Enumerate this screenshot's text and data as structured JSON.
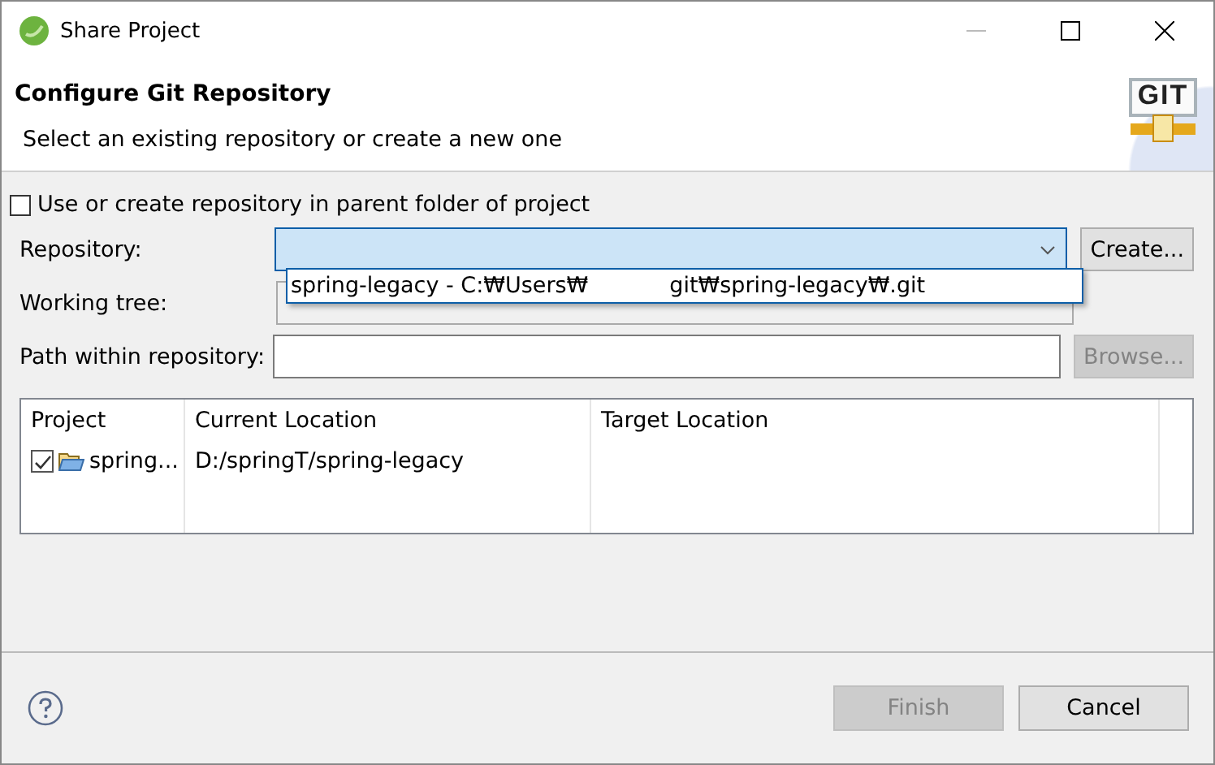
{
  "window": {
    "title": "Share Project"
  },
  "header": {
    "title": "Configure Git Repository",
    "description": "Select an existing repository or create a new one",
    "logo": "GIT"
  },
  "parent_folder_option": {
    "label": "Use or create repository in parent folder of project",
    "checked": false
  },
  "repository": {
    "label": "Repository:",
    "expanded": true,
    "options": [
      {
        "parts": [
          "spring-legacy - C:₩Users₩",
          "git₩spring-legacy₩.git"
        ],
        "selected": true
      }
    ],
    "create_button": "Create..."
  },
  "working_tree": {
    "label": "Working tree:"
  },
  "path_within_repository": {
    "label": "Path within repository:",
    "browse_button": "Browse...",
    "browse_disabled": true
  },
  "table": {
    "columns": [
      "Project",
      "Current Location",
      "Target Location"
    ],
    "rows": [
      {
        "project": "spring...",
        "checked": true,
        "current_location": "D:/springT/spring-legacy"
      }
    ]
  },
  "buttons": [
    {
      "label": "Finish",
      "disabled": true
    },
    {
      "label": "Cancel",
      "disabled": false
    }
  ]
}
